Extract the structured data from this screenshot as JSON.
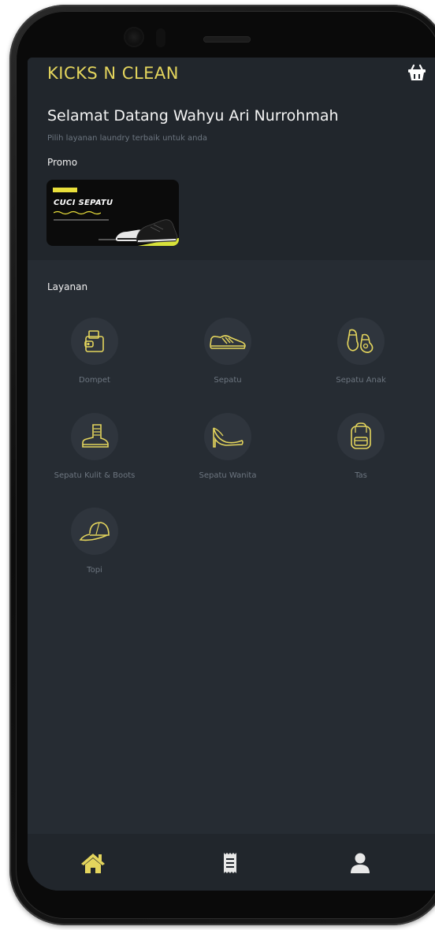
{
  "app": {
    "brand": "KICKS N CLEAN",
    "accent_color": "#e4d55d",
    "background_color": "#262c33",
    "header_background_color": "#21262c"
  },
  "header": {
    "welcome": "Selamat Datang Wahyu Ari Nurrohmah",
    "subtitle": "Pilih layanan laundry terbaik untuk anda",
    "cart_icon": "basket-icon"
  },
  "promo": {
    "label": "Promo",
    "banner_title": "CUCI SEPATU"
  },
  "services": {
    "title": "Layanan",
    "items": [
      {
        "label": "Dompet",
        "icon": "wallet-icon"
      },
      {
        "label": "Sepatu",
        "icon": "sneaker-icon"
      },
      {
        "label": "Sepatu Anak",
        "icon": "kids-shoes-icon"
      },
      {
        "label": "Sepatu Kulit & Boots",
        "icon": "boot-icon"
      },
      {
        "label": "Sepatu Wanita",
        "icon": "heel-icon"
      },
      {
        "label": "Tas",
        "icon": "backpack-icon"
      },
      {
        "label": "Topi",
        "icon": "cap-icon"
      }
    ]
  },
  "bottom_nav": {
    "items": [
      {
        "name": "home",
        "icon": "home-icon",
        "active": true
      },
      {
        "name": "orders",
        "icon": "receipt-icon",
        "active": false
      },
      {
        "name": "profile",
        "icon": "user-icon",
        "active": false
      }
    ],
    "active_color": "#e4d55d",
    "inactive_color": "#e8e8e8"
  }
}
